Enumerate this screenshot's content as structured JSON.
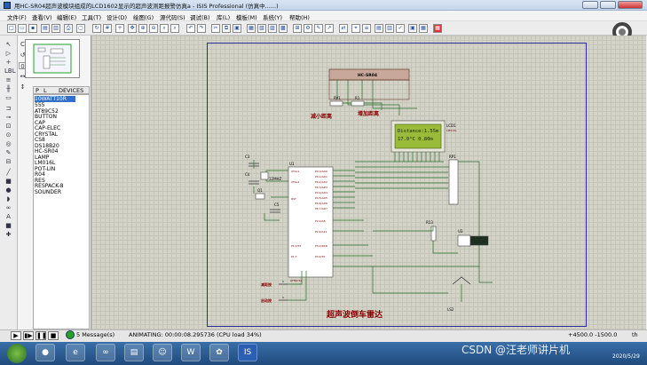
{
  "window": {
    "title": "用HC-SR04超声波模块组成的LCD1602显示的超声波测距报警仿真a - ISIS Professional (仿真中......)"
  },
  "menu": [
    "文件(F)",
    "查看(V)",
    "编辑(E)",
    "工具(T)",
    "设计(D)",
    "绘图(G)",
    "源代码(S)",
    "调试(B)",
    "库(L)",
    "模板(M)",
    "系统(Y)",
    "帮助(H)"
  ],
  "devices": {
    "tabs": [
      "P",
      "L"
    ],
    "header": "DEVICES",
    "items": [
      "10WATT10R",
      "555",
      "AT89C52",
      "BUTTON",
      "CAP",
      "CAP-ELEC",
      "CRYSTAL",
      "CS8",
      "DS18B20",
      "HC-SR04",
      "LAMP",
      "LM016L",
      "POT-LIN",
      "R04",
      "RES",
      "RESPACK-8",
      "SOUNDER"
    ],
    "selected": 0
  },
  "schematic": {
    "sensor": "HC-SR04",
    "lcd": {
      "ref": "LCD1",
      "part": "LM016L",
      "line1": "Distance:1.55m",
      "line2": "17.0°C  0.80m"
    },
    "mcu": {
      "ref": "U1",
      "part": "AT89C52"
    },
    "crystal": "12MHZ",
    "labels": [
      "减小距离",
      "增加距离",
      "超声波倒车雷达"
    ],
    "refs": [
      "RV1",
      "R1",
      "RP1",
      "R13",
      "U3",
      "LS2",
      "C1",
      "C2",
      "C3",
      "C4",
      "C5",
      "Q1"
    ],
    "buttons_left": [
      "减距按",
      "启动按"
    ]
  },
  "status": {
    "messages": "5 Message(s)",
    "animating": "ANIMATING: 00:00:08.295736 (CPU load 34%)",
    "coords": "+4500.0   -1500.0",
    "unit": "th"
  },
  "watermark": "CSDN @汪老师讲片机",
  "clock": {
    "date": "2020/5/29"
  }
}
